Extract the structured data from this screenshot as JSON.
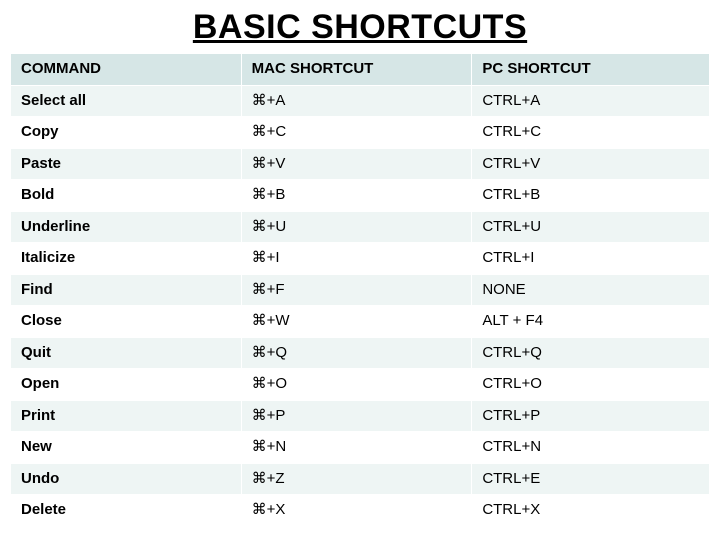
{
  "title": "BASIC SHORTCUTS",
  "headers": {
    "command": "COMMAND",
    "mac": "MAC SHORTCUT",
    "pc": "PC SHORTCUT"
  },
  "rows": [
    {
      "command": "Select all",
      "mac": "⌘+A",
      "pc": "CTRL+A"
    },
    {
      "command": "Copy",
      "mac": "⌘+C",
      "pc": "CTRL+C"
    },
    {
      "command": "Paste",
      "mac": "⌘+V",
      "pc": "CTRL+V"
    },
    {
      "command": "Bold",
      "mac": "⌘+B",
      "pc": "CTRL+B"
    },
    {
      "command": "Underline",
      "mac": "⌘+U",
      "pc": "CTRL+U"
    },
    {
      "command": "Italicize",
      "mac": "⌘+I",
      "pc": "CTRL+I"
    },
    {
      "command": "Find",
      "mac": "⌘+F",
      "pc": "NONE"
    },
    {
      "command": "Close",
      "mac": "⌘+W",
      "pc": "ALT + F4"
    },
    {
      "command": "Quit",
      "mac": "⌘+Q",
      "pc": "CTRL+Q"
    },
    {
      "command": "Open",
      "mac": "⌘+O",
      "pc": "CTRL+O"
    },
    {
      "command": "Print",
      "mac": "⌘+P",
      "pc": "CTRL+P"
    },
    {
      "command": "New",
      "mac": "⌘+N",
      "pc": "CTRL+N"
    },
    {
      "command": "Undo",
      "mac": "⌘+Z",
      "pc": "CTRL+E"
    },
    {
      "command": "Delete",
      "mac": "⌘+X",
      "pc": "CTRL+X"
    }
  ]
}
